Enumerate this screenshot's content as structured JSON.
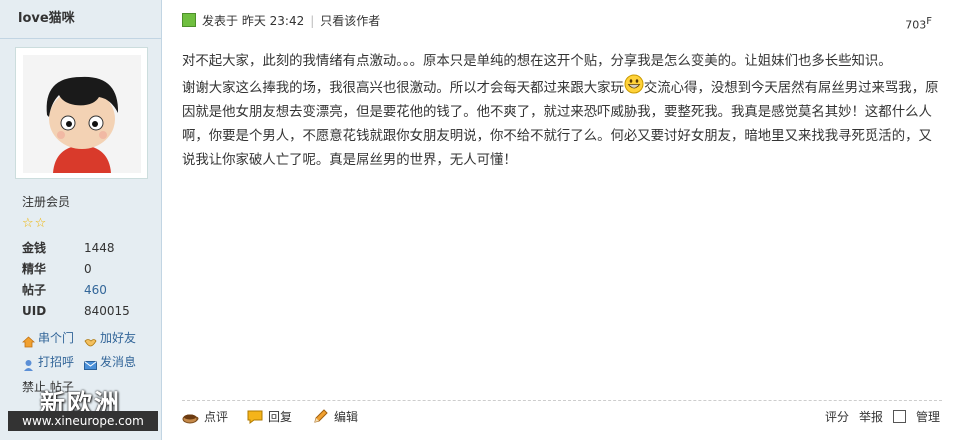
{
  "user": {
    "name": "love猫咪",
    "group": "注册会员",
    "stars": "☆☆",
    "stats": [
      {
        "label": "金钱",
        "value": "1448"
      },
      {
        "label": "精华",
        "value": "0"
      },
      {
        "label": "帖子",
        "value": "460"
      },
      {
        "label": "UID",
        "value": "840015"
      }
    ],
    "actions": {
      "visit": "串个门",
      "add_friend": "加好友",
      "greet": "打招呼",
      "message": "发消息"
    },
    "ban_text": "禁止 帖子"
  },
  "watermark": {
    "name": "新欧洲",
    "url": "www.xineurope.com"
  },
  "post": {
    "posted": "发表于 昨天 23:42",
    "only_author": "只看该作者",
    "floor": "703",
    "floor_suffix": "F",
    "line1": "对不起大家，此刻的我情绪有点激动。。。原本只是单纯的想在这开个贴，分享我是怎么变美的。让姐妹们也多长些知识。",
    "line2a": "谢谢大家这么捧我的场，我很高兴也很激动。所以才会每天都过来跟大家玩",
    "line2b": "交流心得，没想到今天居然有屌丝男过来骂我，原因就是他女朋友想去变漂亮，但是要花他的钱了。他不爽了，就过来恐吓威胁我，要整死我。我真是感觉莫名其妙！这都什么人啊，你要是个男人，不愿意花钱就跟你女朋友明说，你不给不就行了么。何必又要讨好女朋友，暗地里又来找我寻死觅活的，又说我让你家破人亡了呢。真是屌丝男的世界，无人可懂！"
  },
  "footer": {
    "rate": "点评",
    "reply": "回复",
    "edit": "编辑",
    "score": "评分",
    "report": "举报",
    "manage": "管理"
  }
}
